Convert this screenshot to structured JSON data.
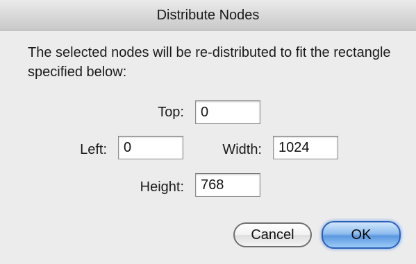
{
  "dialog": {
    "title": "Distribute Nodes",
    "message": "The selected nodes will be re-distributed to fit the rectangle specified below:"
  },
  "fields": {
    "top": {
      "label": "Top:",
      "value": "0"
    },
    "left": {
      "label": "Left:",
      "value": "0"
    },
    "width": {
      "label": "Width:",
      "value": "1024"
    },
    "height": {
      "label": "Height:",
      "value": "768"
    }
  },
  "buttons": {
    "cancel_label": "Cancel",
    "ok_label": "OK"
  }
}
